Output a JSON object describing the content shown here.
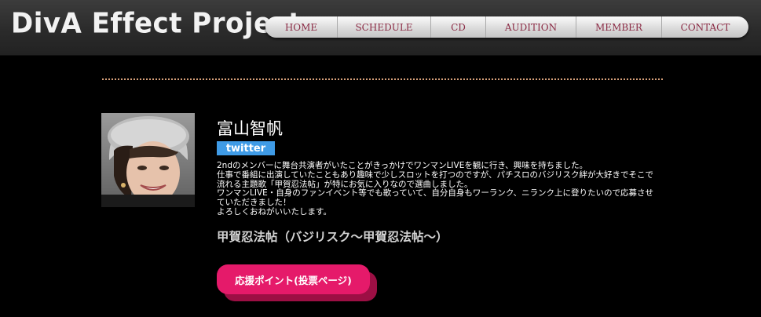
{
  "header": {
    "logo_text": "DivA Effect Project",
    "nav": [
      {
        "label": "HOME"
      },
      {
        "label": "SCHEDULE"
      },
      {
        "label": "CD"
      },
      {
        "label": "AUDITION"
      },
      {
        "label": "MEMBER"
      },
      {
        "label": "CONTACT"
      }
    ]
  },
  "member": {
    "name": "富山智帆",
    "twitter_label": "twitter",
    "bio_lines": [
      "2ndのメンバーに舞台共演者がいたことがきっかけでワンマンLIVEを観に行き、興味を持ちました。",
      "仕事で番組に出演していたこともあり趣味で少しスロットを打つのですが、パチスロのバジリスク絆が大好きでそこで流れる主題歌「甲賀忍法帖」が特にお気に入りなので選曲しました。",
      "ワンマンLIVE・自身のファンイベント等でも歌っていて、自分自身もワーランク、ニランク上に登りたいので応募させていただきました！",
      "よろしくおねがいいたします。"
    ],
    "song": "甲賀忍法帖（バジリスク～甲賀忍法帖～）",
    "vote_button": "応援ポイント(投票ページ)"
  },
  "colors": {
    "background": "#000000",
    "nav_text": "#8b2b45",
    "divider": "#d7a07a",
    "twitter_badge": "#3f9be6",
    "vote_button": "#e51a6a",
    "vote_button_shadow": "#9c0f44"
  }
}
